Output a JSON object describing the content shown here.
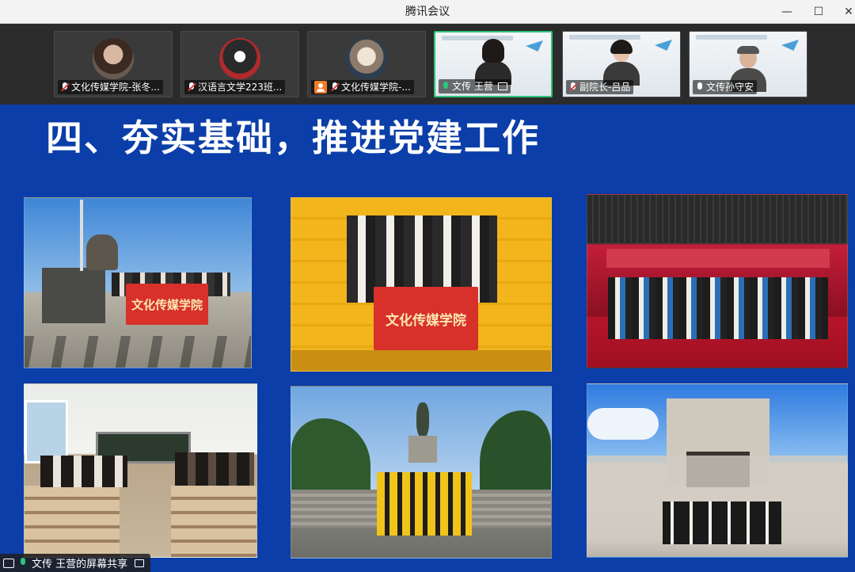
{
  "window": {
    "title": "腾讯会议"
  },
  "participants": [
    {
      "name": "文化传媒学院-张冬...",
      "mic": "muted",
      "type": "avatar",
      "avatar_style": "av1"
    },
    {
      "name": "汉语言文学223班...",
      "mic": "muted",
      "type": "avatar",
      "avatar_style": "av2"
    },
    {
      "name": "文化传媒学院-...",
      "mic": "muted",
      "type": "avatar",
      "avatar_style": "av3",
      "has_user_icon": true
    },
    {
      "name": "文传 王营",
      "mic": "on",
      "type": "video",
      "active": true
    },
    {
      "name": "副院长-吕品",
      "mic": "muted",
      "type": "video"
    },
    {
      "name": "文传孙守安",
      "mic": "on-white",
      "type": "video"
    }
  ],
  "slide": {
    "title": "四、夯实基础，推进党建工作",
    "photos": [
      {
        "name": "photo-monument-flag",
        "flag_text": "文化传媒学院"
      },
      {
        "name": "photo-yellow-steps",
        "flag_text": "文化传媒学院"
      },
      {
        "name": "photo-stage-group"
      },
      {
        "name": "photo-classroom"
      },
      {
        "name": "photo-statue-square"
      },
      {
        "name": "photo-gate-museum"
      }
    ]
  },
  "share_bar": {
    "text": "文传 王营的屏幕共享"
  },
  "colors": {
    "slide_bg": "#0b3ea8",
    "active_border": "#2ec47a",
    "muted_red": "#e23b3b"
  }
}
